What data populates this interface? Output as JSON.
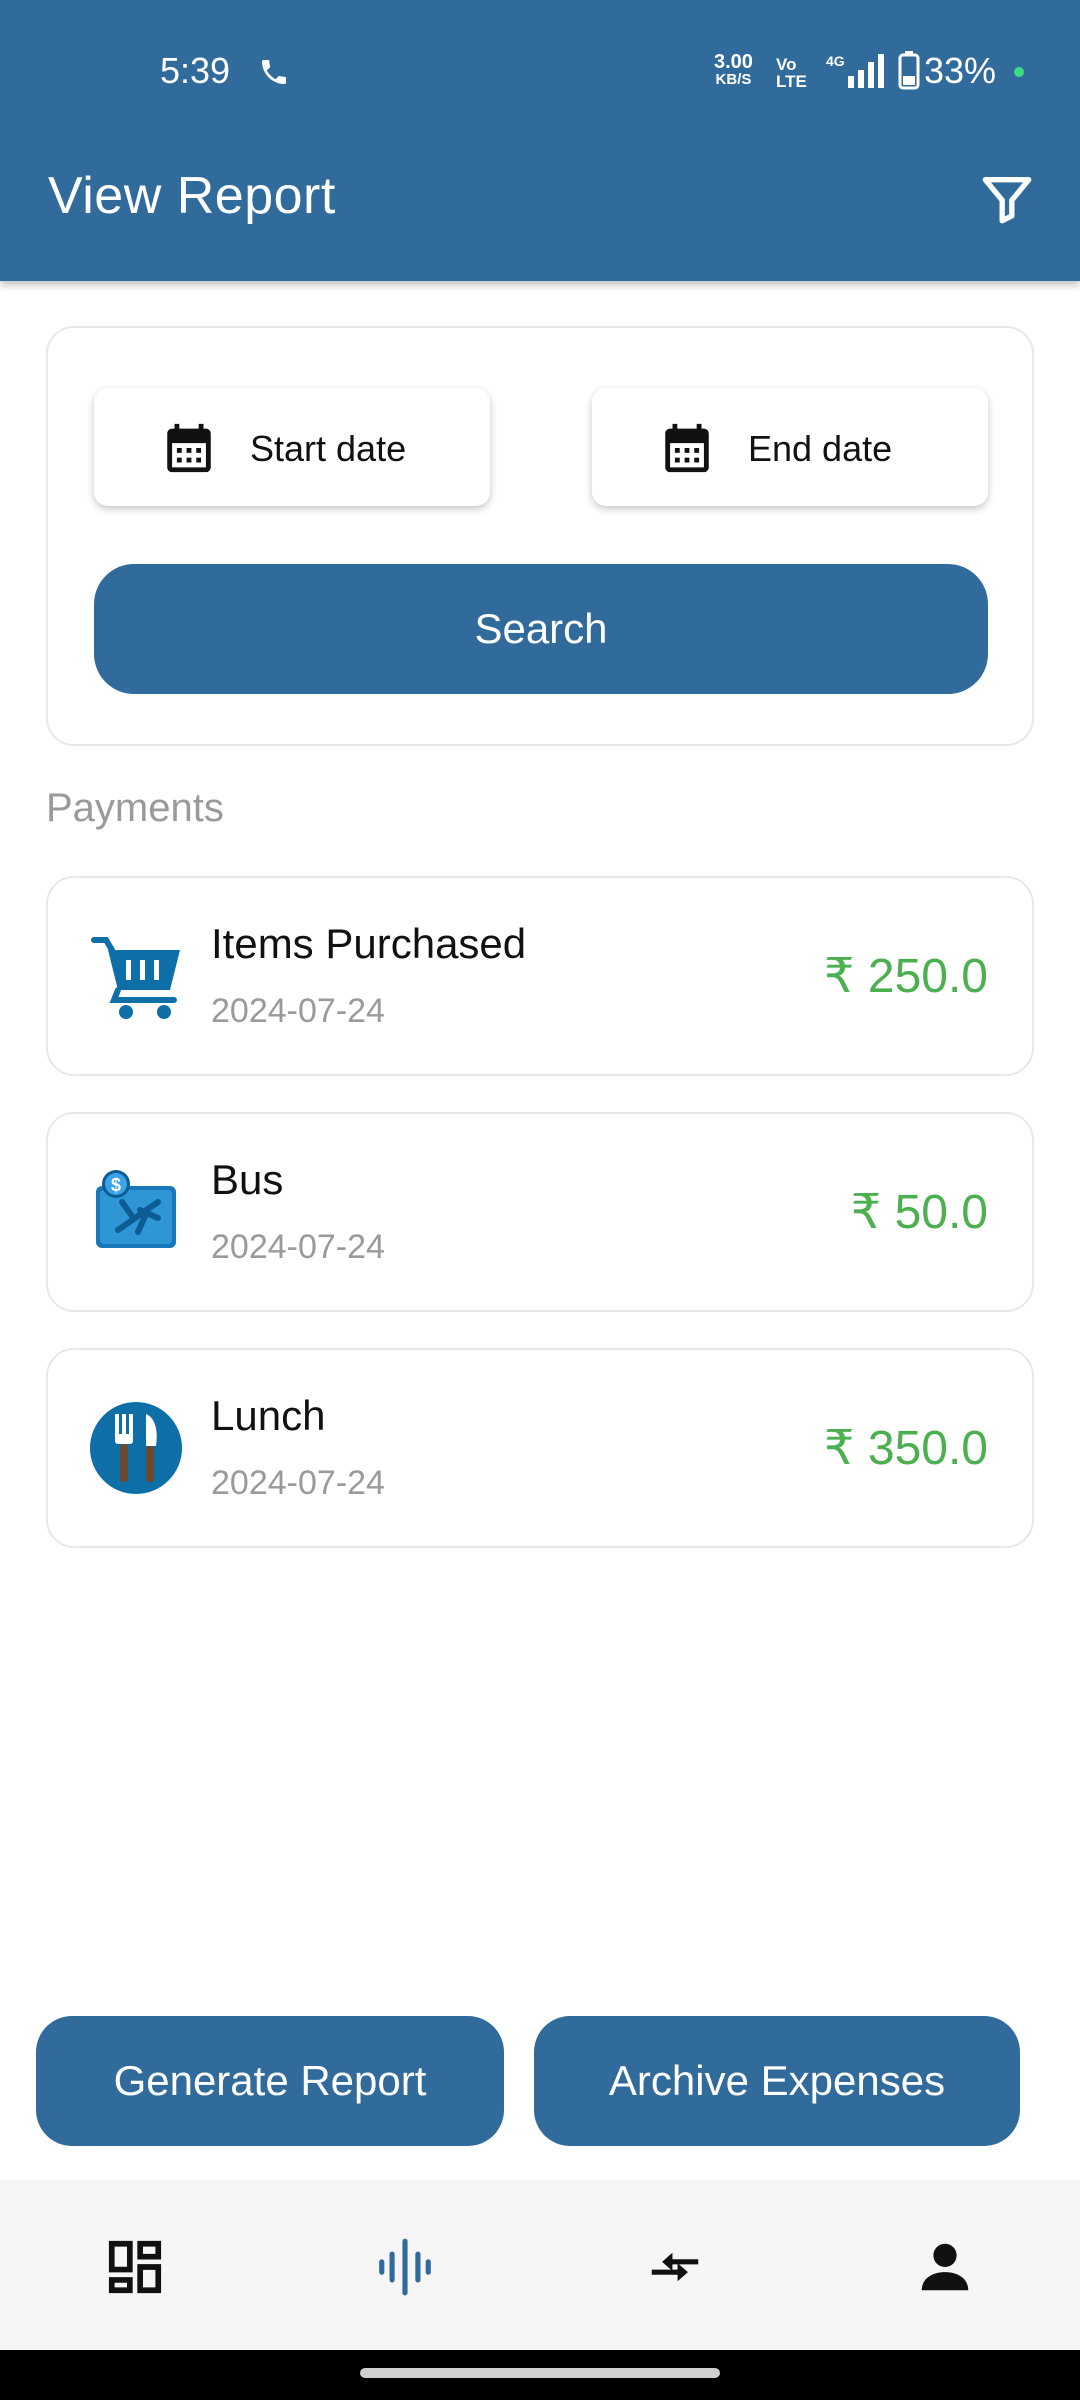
{
  "status_bar": {
    "time": "5:39",
    "net_speed_value": "3.00",
    "net_speed_unit": "KB/S",
    "volte": "Vo LTE",
    "network": "4G",
    "battery": "33%"
  },
  "header": {
    "title": "View Report",
    "filter_icon": "filter-icon",
    "color": "#306b9c"
  },
  "date_filter": {
    "start_label": "Start date",
    "end_label": "End date",
    "search_label": "Search",
    "calendar_icon": "calendar-icon"
  },
  "payments": {
    "section_title": "Payments",
    "items": [
      {
        "name": "Items Purchased",
        "date": "2024-07-24",
        "amount": "₹ 250.0",
        "icon": "shopping-cart-icon"
      },
      {
        "name": "Bus",
        "date": "2024-07-24",
        "amount": "₹ 50.0",
        "icon": "travel-ticket-icon"
      },
      {
        "name": "Lunch",
        "date": "2024-07-24",
        "amount": "₹ 350.0",
        "icon": "fork-knife-icon"
      }
    ],
    "amount_color": "#4caf50"
  },
  "actions": {
    "generate_report": "Generate Report",
    "archive_expenses": "Archive Expenses"
  },
  "bottom_nav": [
    {
      "icon": "dashboard-icon"
    },
    {
      "icon": "audio-wave-icon"
    },
    {
      "icon": "transfer-arrows-icon"
    },
    {
      "icon": "person-icon"
    }
  ]
}
